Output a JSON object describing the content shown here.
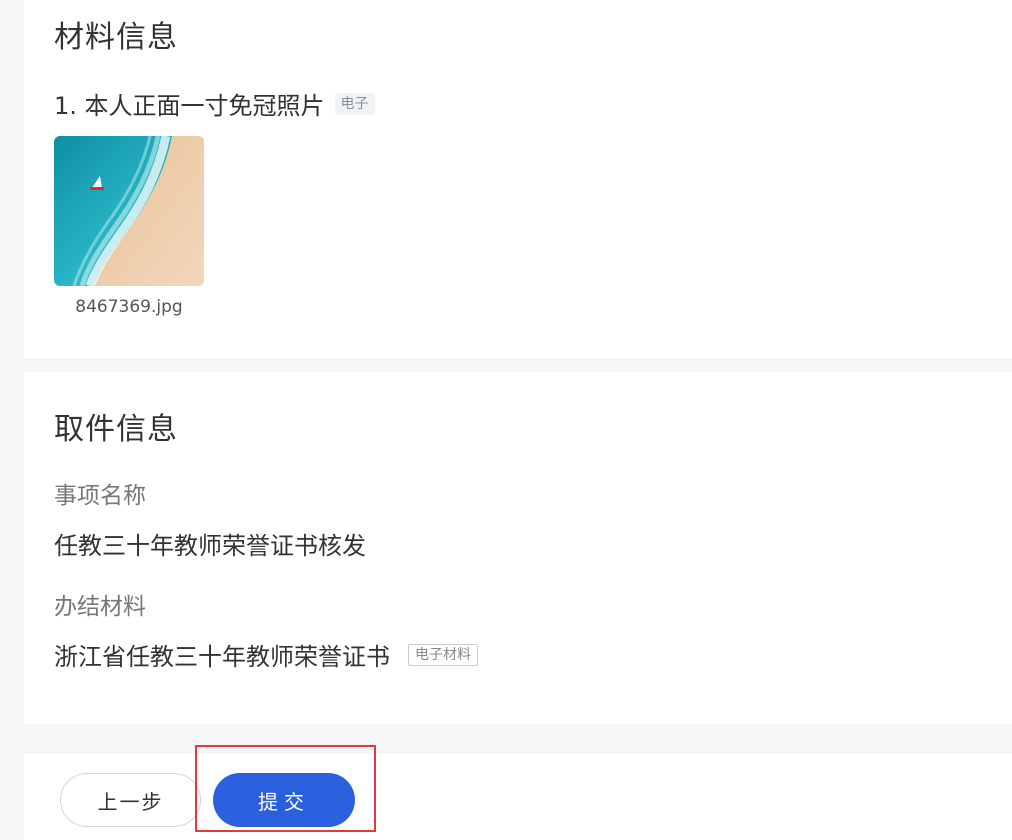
{
  "materials": {
    "title": "材料信息",
    "item_label": "1. 本人正面一寸免冠照片",
    "item_tag": "电子",
    "file_name": "8467369.jpg"
  },
  "pickup": {
    "title": "取件信息",
    "matter_label": "事项名称",
    "matter_value": "任教三十年教师荣誉证书核发",
    "result_label": "办结材料",
    "result_value": "浙江省任教三十年教师荣誉证书",
    "result_tag": "电子材料"
  },
  "actions": {
    "prev_label": "上一步",
    "submit_label": "提交"
  },
  "colors": {
    "primary": "#2a5fdd",
    "highlight": "#e03a3a"
  }
}
